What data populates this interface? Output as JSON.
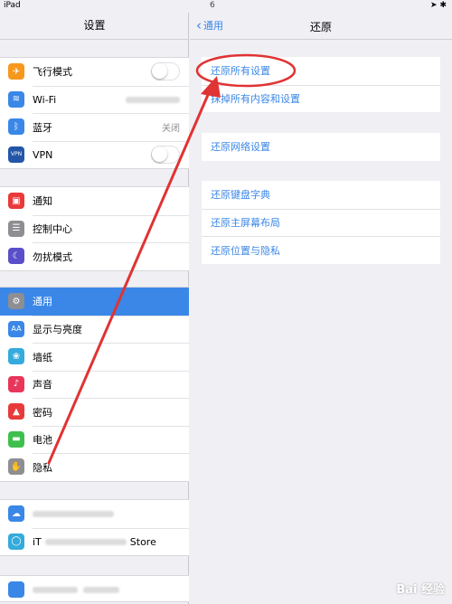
{
  "status": {
    "device": "iPad",
    "time": "6",
    "right": "➤ ✱"
  },
  "sidebar": {
    "title": "设置",
    "group1": [
      {
        "label": "飞行模式",
        "icon": "airplane-icon",
        "color": "#f7981d",
        "glyph": "✈",
        "control": "toggle"
      },
      {
        "label": "Wi-Fi",
        "icon": "wifi-icon",
        "color": "#3a87e8",
        "glyph": "≋",
        "control": "blur"
      },
      {
        "label": "蓝牙",
        "icon": "bluetooth-icon",
        "color": "#3a87e8",
        "glyph": "ᛒ",
        "control": "value",
        "value": "关闭"
      },
      {
        "label": "VPN",
        "icon": "vpn-icon",
        "color": "#2456a8",
        "glyph": "VPN",
        "control": "toggle"
      }
    ],
    "group2": [
      {
        "label": "通知",
        "icon": "notifications-icon",
        "color": "#e83a3a",
        "glyph": "▣"
      },
      {
        "label": "控制中心",
        "icon": "control-center-icon",
        "color": "#8e8e93",
        "glyph": "☰"
      },
      {
        "label": "勿扰模式",
        "icon": "do-not-disturb-icon",
        "color": "#5b4fc9",
        "glyph": "☾"
      }
    ],
    "group3": [
      {
        "label": "通用",
        "icon": "gear-icon",
        "color": "#8e8e93",
        "glyph": "⚙",
        "selected": true
      },
      {
        "label": "显示与亮度",
        "icon": "display-icon",
        "color": "#3a87e8",
        "glyph": "AA"
      },
      {
        "label": "墙纸",
        "icon": "wallpaper-icon",
        "color": "#35aadc",
        "glyph": "❀"
      },
      {
        "label": "声音",
        "icon": "sound-icon",
        "color": "#e8365a",
        "glyph": "♪"
      },
      {
        "label": "密码",
        "icon": "passcode-icon",
        "color": "#e83a3a",
        "glyph": "▲"
      },
      {
        "label": "电池",
        "icon": "battery-icon",
        "color": "#3fc04e",
        "glyph": "▬"
      },
      {
        "label": "隐私",
        "icon": "privacy-hand-icon",
        "color": "#8e8e93",
        "glyph": "✋"
      }
    ],
    "group4": [
      {
        "label": "",
        "icon": "icloud-icon",
        "color": "#3a87e8",
        "glyph": "☁"
      },
      {
        "label": "iT",
        "label_end": "Store",
        "icon": "itunes-store-icon",
        "color": "#35aadc",
        "glyph": "◯"
      }
    ]
  },
  "detail": {
    "back_label": "通用",
    "title": "还原",
    "group1": [
      "还原所有设置",
      "抹掉所有内容和设置"
    ],
    "group2": [
      "还原网络设置"
    ],
    "group3": [
      "还原键盘字典",
      "还原主屏幕布局",
      "还原位置与隐私"
    ]
  },
  "watermark": "Bai 经验",
  "colors": {
    "accent": "#3a87e8",
    "annotation": "#e03333"
  }
}
